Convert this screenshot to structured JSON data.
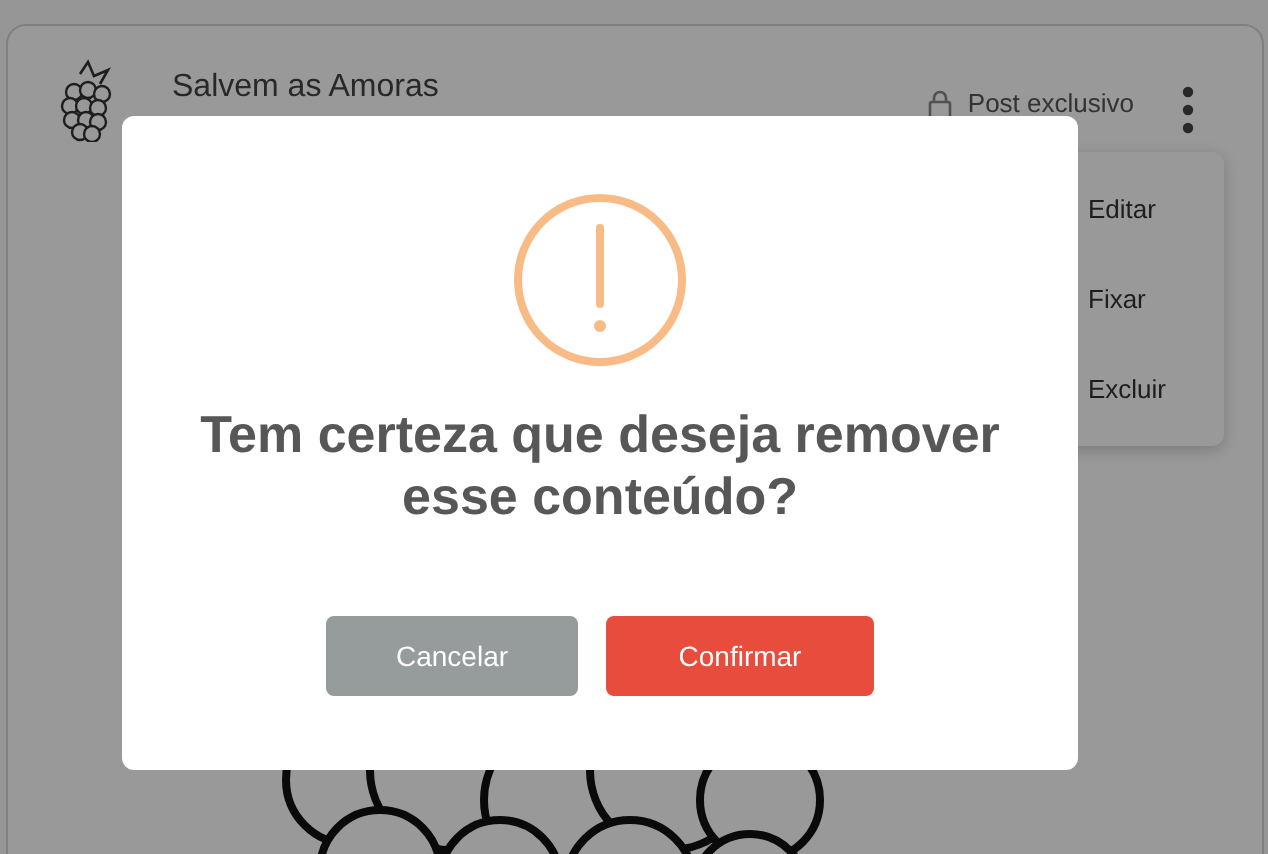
{
  "post": {
    "title": "Salvem as Amoras",
    "badge": "Post exclusivo"
  },
  "menu": {
    "items": [
      {
        "label": "Editar"
      },
      {
        "label": "Fixar"
      },
      {
        "label": "Excluir"
      }
    ]
  },
  "dialog": {
    "title": "Tem certeza que deseja remover esse conteúdo?",
    "buttons": [
      {
        "label": "Cancelar",
        "kind": "secondary"
      },
      {
        "label": "Confirmar",
        "kind": "primary"
      }
    ]
  }
}
